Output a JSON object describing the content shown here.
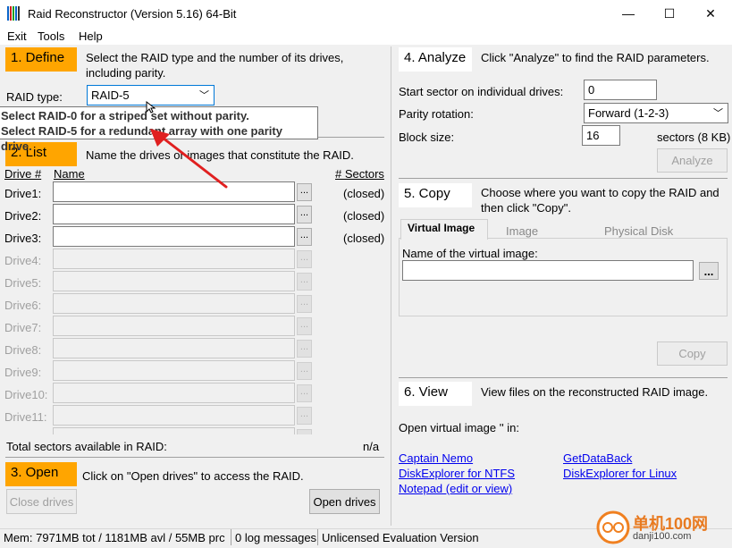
{
  "window": {
    "title": "Raid Reconstructor (Version 5.16) 64-Bit",
    "minimize_glyph": "—",
    "maximize_glyph": "☐",
    "close_glyph": "✕"
  },
  "menu": [
    "Exit",
    "Tools",
    "Help"
  ],
  "define": {
    "step": "1. Define",
    "description": "Select the RAID type and the number of its drives, including parity.",
    "raid_type_label": "RAID type:",
    "raid_type_value": "RAID-5",
    "tooltip_line1": "Select RAID-0 for a striped set without parity.",
    "tooltip_line2": "Select RAID-5 for a redundant array with one parity drive."
  },
  "list": {
    "step": "2. List",
    "description": "Name the drives or images that constitute the RAID.",
    "col_drive": "Drive #",
    "col_name": "Name",
    "col_sectors": "# Sectors",
    "drives": [
      {
        "label": "Drive1:",
        "status": "(closed)",
        "enabled": true
      },
      {
        "label": "Drive2:",
        "status": "(closed)",
        "enabled": true
      },
      {
        "label": "Drive3:",
        "status": "(closed)",
        "enabled": true
      },
      {
        "label": "Drive4:",
        "status": "",
        "enabled": false
      },
      {
        "label": "Drive5:",
        "status": "",
        "enabled": false
      },
      {
        "label": "Drive6:",
        "status": "",
        "enabled": false
      },
      {
        "label": "Drive7:",
        "status": "",
        "enabled": false
      },
      {
        "label": "Drive8:",
        "status": "",
        "enabled": false
      },
      {
        "label": "Drive9:",
        "status": "",
        "enabled": false
      },
      {
        "label": "Drive10:",
        "status": "",
        "enabled": false
      },
      {
        "label": "Drive11:",
        "status": "",
        "enabled": false
      }
    ],
    "browse_label": "...",
    "total_label": "Total sectors available in RAID:",
    "total_value": "n/a"
  },
  "open": {
    "step": "3. Open",
    "description": "Click on \"Open drives\" to access the RAID.",
    "close_button": "Close drives",
    "open_button": "Open drives"
  },
  "analyze": {
    "step": "4. Analyze",
    "description": "Click \"Analyze\" to find the RAID parameters.",
    "start_sector_label": "Start sector on individual drives:",
    "start_sector_value": "0",
    "parity_label": "Parity rotation:",
    "parity_value": "Forward (1-2-3)",
    "block_label": "Block size:",
    "block_value": "16",
    "block_unit": "sectors (8 KB)",
    "analyze_button": "Analyze"
  },
  "copy": {
    "step": "5. Copy",
    "description": "Choose where you want to copy the RAID and then click \"Copy\".",
    "tabs": [
      "Virtual Image",
      "Image",
      "Physical Disk"
    ],
    "name_label": "Name of the virtual image:",
    "browse_label": "...",
    "copy_button": "Copy"
  },
  "view": {
    "step": "6. View",
    "description": "View files on the reconstructed RAID image.",
    "open_in_label": "Open virtual image '' in:",
    "links_left": [
      "Captain Nemo",
      "DiskExplorer for NTFS",
      "Notepad (edit or view)"
    ],
    "links_right": [
      "GetDataBack",
      "DiskExplorer for Linux"
    ]
  },
  "statusbar": {
    "mem": "Mem: 7971MB tot / 1181MB avl / 55MB prc",
    "log": "0 log messages",
    "license": "Unlicensed Evaluation Version"
  },
  "watermark": {
    "site_name": "单机100网",
    "site_url": "danji100.com"
  },
  "colors": {
    "step_orange": "#ffa500",
    "link_blue": "#0000ee",
    "arrow_red": "#e02020"
  }
}
